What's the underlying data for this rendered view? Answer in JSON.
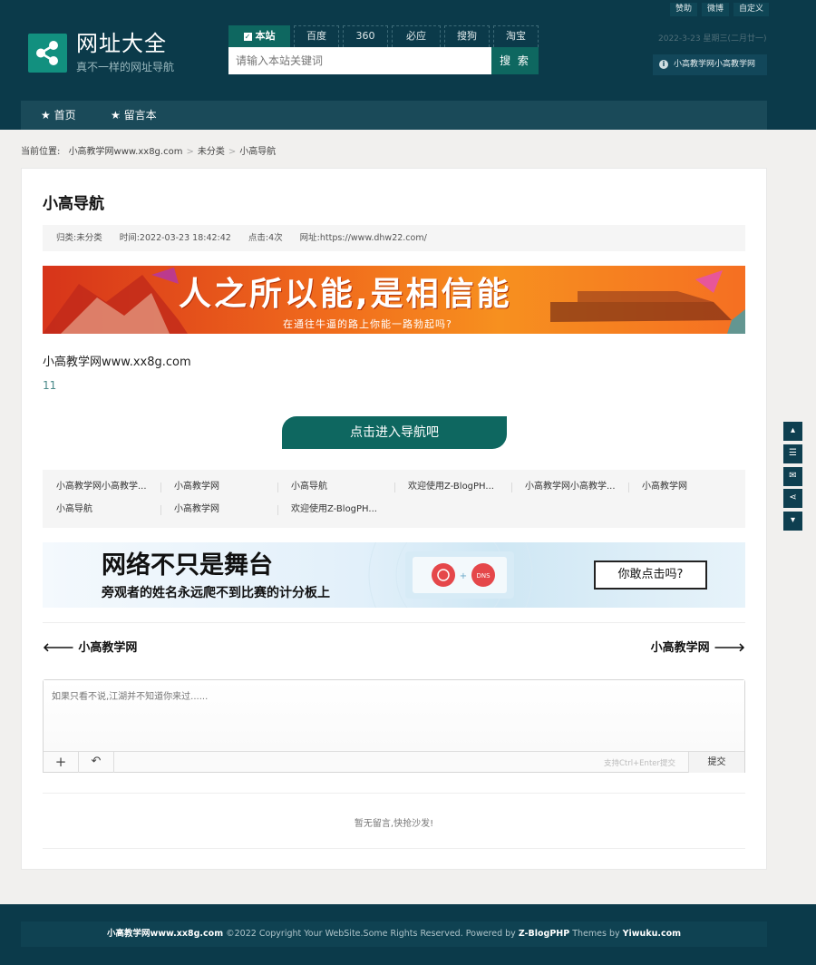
{
  "header": {
    "top_links": [
      "赞助",
      "微博",
      "自定义"
    ],
    "logo_title": "网址大全",
    "logo_subtitle": "真不一样的网址导航",
    "engines": [
      "本站",
      "百度",
      "360",
      "必应",
      "搜狗",
      "淘宝"
    ],
    "active_engine": "本站",
    "search_placeholder": "请输入本站关键词",
    "search_button": "搜 索",
    "date": "2022-3-23 星期三(二月廿一)",
    "notice": "小高教学网小高教学网"
  },
  "nav": {
    "items": [
      "首页",
      "留言本"
    ]
  },
  "breadcrumb": {
    "label": "当前位置:",
    "items": [
      "小高教学网www.xx8g.com",
      "未分类",
      "小高导航"
    ]
  },
  "article": {
    "title": "小高导航",
    "meta": {
      "category": "归类:未分类",
      "time": "时间:2022-03-23 18:42:42",
      "clicks": "点击:4次",
      "url": "网址:https://www.dhw22.com/"
    },
    "banner1": {
      "headline": "人之所以能,是相信能",
      "subline": "在通往牛逼的路上你能一路勃起吗?"
    },
    "body_text": "小高教学网www.xx8g.com",
    "body_number": "11",
    "go_button": "点击进入导航吧",
    "related_links": [
      "小高教学网小高教学...",
      "小高教学网",
      "小高导航",
      "欢迎使用Z-BlogPH...",
      "小高教学网小高教学...",
      "小高教学网",
      "小高导航",
      "小高教学网",
      "欢迎使用Z-BlogPH..."
    ],
    "banner2": {
      "headline": "网络不只是舞台",
      "subline": "旁观者的姓名永远爬不到比赛的计分板上",
      "button": "你敢点击吗?"
    },
    "prev": "小高教学网",
    "next": "小高教学网"
  },
  "comment": {
    "placeholder": "如果只看不说,江湖并不知道你来过......",
    "hint": "支持Ctrl+Enter提交",
    "submit": "提交",
    "empty": "暂无留言,快抢沙发!"
  },
  "footer": {
    "site": "小高教学网www.xx8g.com",
    "copyright": " ©2022 Copyright Your WebSite.Some Rights Reserved. Powered by ",
    "powered": "Z-BlogPHP",
    "themes_by": " Themes by ",
    "theme_author": "Yiwuku.com"
  },
  "colors": {
    "header_bg": "#0b3a4a",
    "accent": "#0e6760",
    "nav_bg": "#1a4a59"
  },
  "icons": [
    "share-icon",
    "star-icon",
    "info-icon",
    "arrow-left-icon",
    "arrow-right-icon",
    "plus-icon",
    "reply-icon",
    "top-icon",
    "list-icon",
    "chat-icon",
    "share-icon",
    "bottom-icon"
  ]
}
